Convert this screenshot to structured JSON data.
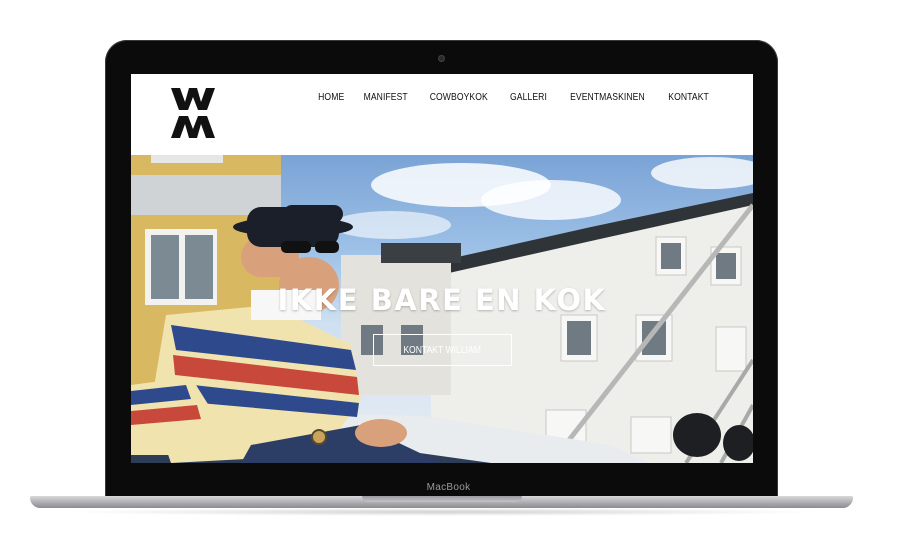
{
  "device": {
    "brand_label": "MacBook"
  },
  "site": {
    "logo_alt": "WM",
    "nav": [
      {
        "label": "HOME"
      },
      {
        "label": "MANIFEST"
      },
      {
        "label": "COWBOYKOK"
      },
      {
        "label": "GALLERI"
      },
      {
        "label": "EVENTMASKINEN"
      },
      {
        "label": "KONTAKT"
      }
    ]
  },
  "hero": {
    "title": "IKKE BARE EN KOK",
    "button_label": "KONTAKT WILLIAM"
  },
  "colors": {
    "text_dark": "#111111",
    "hero_text": "#ffffff",
    "laptop_body": "#0b0b0b"
  }
}
